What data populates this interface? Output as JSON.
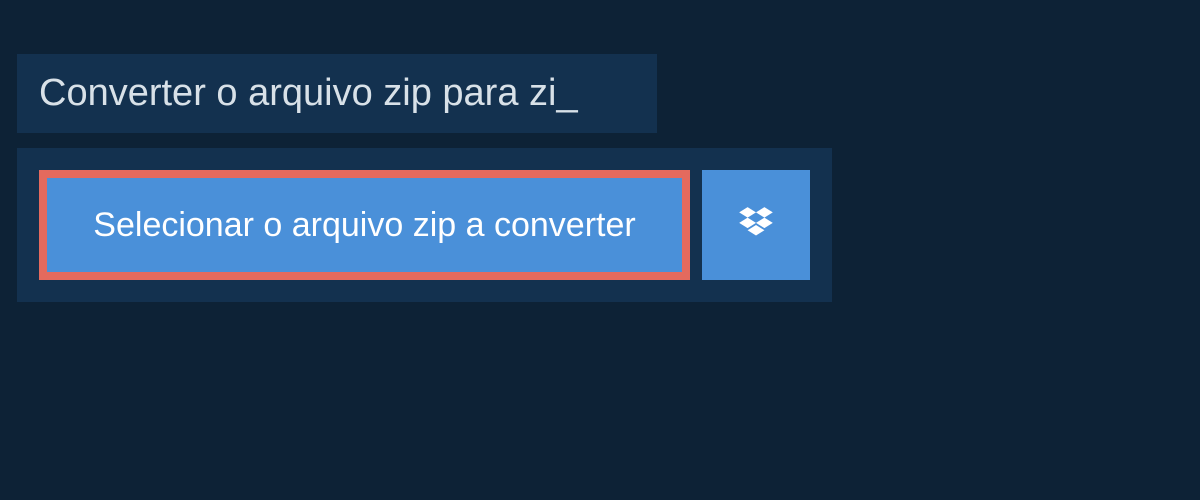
{
  "title": {
    "text": "Converter o arquivo zip para zi_"
  },
  "buttons": {
    "select_label": "Selecionar o arquivo zip a converter"
  },
  "colors": {
    "background": "#0d2236",
    "panel": "#13314f",
    "button": "#4a90d9",
    "highlight_border": "#e46a5e",
    "text_light": "#d8e1e8",
    "text_white": "#ffffff"
  }
}
